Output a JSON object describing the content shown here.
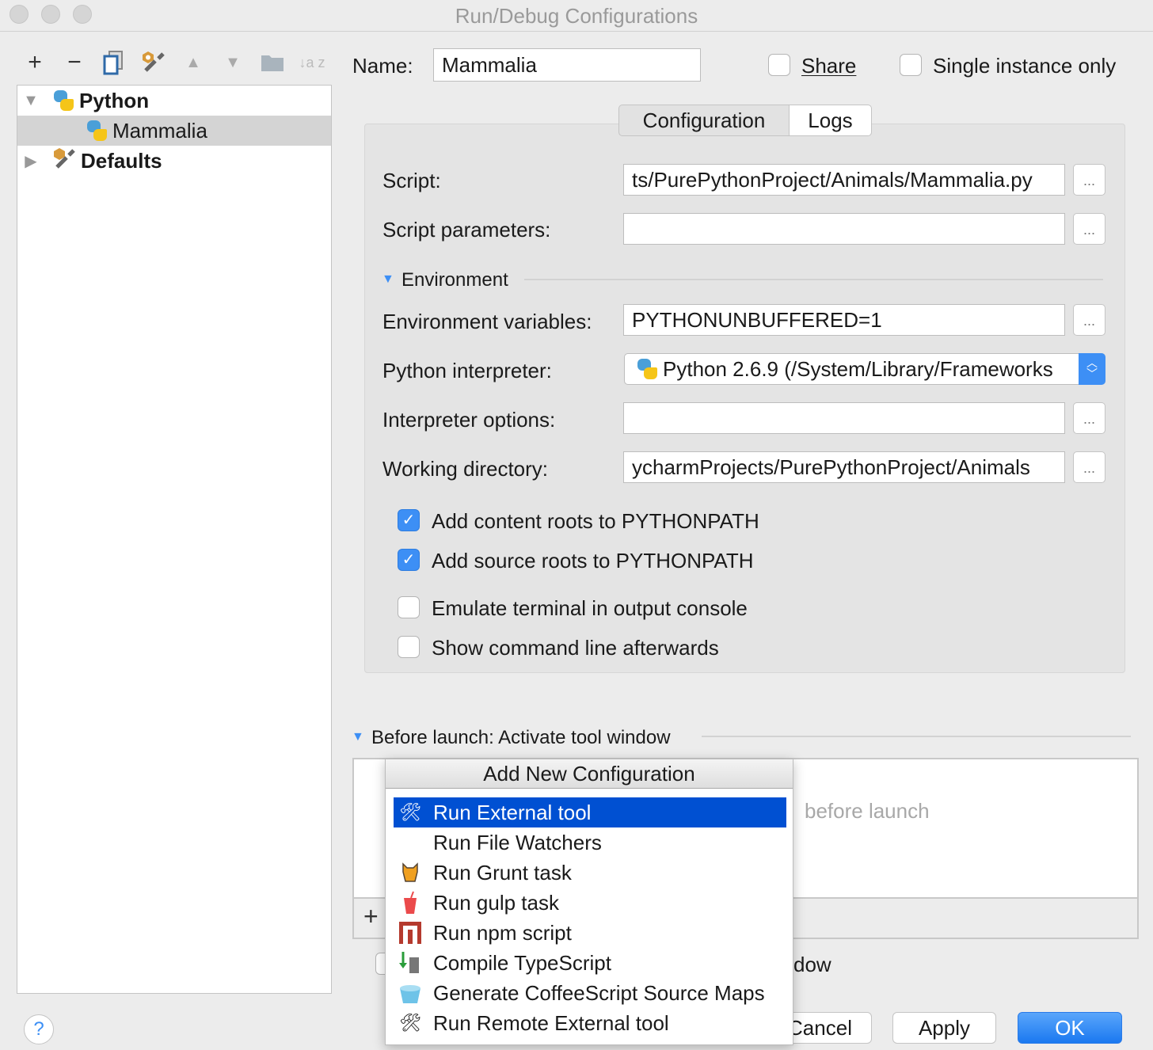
{
  "window": {
    "title": "Run/Debug Configurations"
  },
  "toolbar": {
    "add": "+",
    "remove": "−",
    "copy": "copy-icon",
    "edit_defaults": "wrench-icon",
    "up": "▲",
    "down": "▼",
    "folder": "folder-icon",
    "sort": "↓a z"
  },
  "tree": [
    {
      "label": "Python",
      "expanded": true
    },
    {
      "label": "Mammalia",
      "selected": true
    },
    {
      "label": "Defaults",
      "expanded": false
    }
  ],
  "name": {
    "label": "Name:",
    "value": "Mammalia"
  },
  "share": {
    "label": "Share",
    "checked": false
  },
  "single_instance": {
    "label": "Single instance only",
    "checked": false
  },
  "tabs": [
    {
      "label": "Configuration",
      "active": true
    },
    {
      "label": "Logs",
      "active": false
    }
  ],
  "form": {
    "script": {
      "label": "Script:",
      "value": "ts/PurePythonProject/Animals/Mammalia.py"
    },
    "script_params": {
      "label": "Script parameters:",
      "value": ""
    },
    "environment_header": "Environment",
    "env_vars": {
      "label": "Environment variables:",
      "value": "PYTHONUNBUFFERED=1"
    },
    "interpreter": {
      "label": "Python interpreter:",
      "value": "Python 2.6.9 (/System/Library/Frameworks"
    },
    "interp_options": {
      "label": "Interpreter options:",
      "value": ""
    },
    "working_dir": {
      "label": "Working directory:",
      "value": "ycharmProjects/PurePythonProject/Animals"
    },
    "browse": "...",
    "checkboxes": [
      {
        "label": "Add content roots to PYTHONPATH",
        "checked": true
      },
      {
        "label": "Add source roots to PYTHONPATH",
        "checked": true
      },
      {
        "label": "Emulate terminal in output console",
        "checked": false
      },
      {
        "label": "Show command line afterwards",
        "checked": false
      }
    ]
  },
  "before_launch": {
    "header": "Before launch: Activate tool window",
    "empty_text": "before launch",
    "add": "+",
    "checkbox_fragment": "dow"
  },
  "popup": {
    "title": "Add New Configuration",
    "items": [
      {
        "label": "Run External tool",
        "selected": true
      },
      {
        "label": "Run File Watchers"
      },
      {
        "label": "Run Grunt task"
      },
      {
        "label": "Run gulp task"
      },
      {
        "label": "Run npm script"
      },
      {
        "label": "Compile TypeScript"
      },
      {
        "label": "Generate CoffeeScript Source Maps"
      },
      {
        "label": "Run Remote External tool"
      }
    ]
  },
  "buttons": {
    "help": "?",
    "cancel": "Cancel",
    "apply": "Apply",
    "ok": "OK"
  },
  "colors": {
    "accent": "#3d8ff5",
    "selection": "#0050d2"
  }
}
